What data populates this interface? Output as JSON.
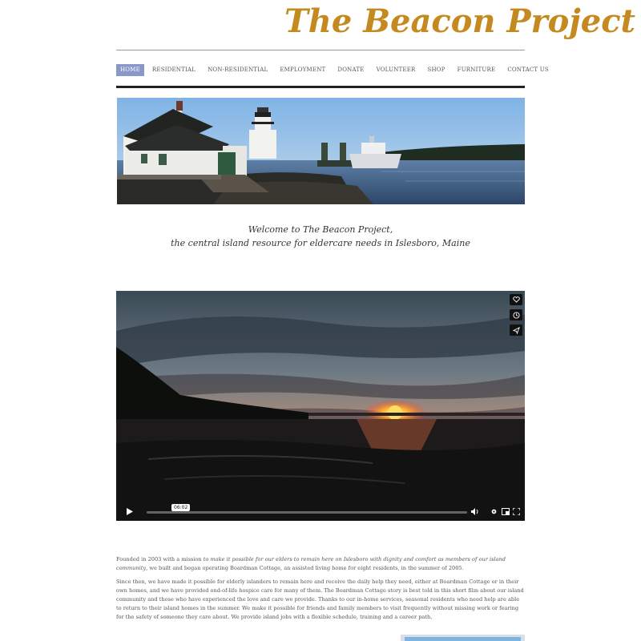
{
  "site": {
    "title": "The Beacon Project"
  },
  "nav": {
    "items": [
      {
        "label": "HOME",
        "active": true
      },
      {
        "label": "RESIDENTIAL"
      },
      {
        "label": "NON-RESIDENTIAL"
      },
      {
        "label": "EMPLOYMENT"
      },
      {
        "label": "DONATE"
      },
      {
        "label": "VOLUNTEER"
      },
      {
        "label": "SHOP"
      },
      {
        "label": "FURNITURE"
      },
      {
        "label": "CONTACT US"
      }
    ]
  },
  "hero": {
    "alt": "Lighthouse and cottage at dusk"
  },
  "welcome": {
    "line1": "Welcome to The Beacon Project,",
    "line2": "the central island resource for eldercare needs in Islesboro, Maine"
  },
  "video": {
    "timecode": "06:02",
    "side_buttons": [
      "heart-icon",
      "clock-icon",
      "send-icon"
    ],
    "controls": [
      "play-icon",
      "volume-icon",
      "settings-icon",
      "pip-icon",
      "fullscreen-icon"
    ]
  },
  "body": {
    "p1_a": "Founded in 2003 with a mission ",
    "p1_em": "to make it possible for our elders to remain here on Islesboro with dignity and comfort as members of our island community",
    "p1_b": ", we built and began operating Boardman Cottage, an assisted living home for eight residents, in the summer of 2005.",
    "p2": "Since then, we have made it possible for elderly islanders to remain here and receive the daily help they need, either at Boardman Cottage or in their own homes, and we have provided end-of-life hospice care for many of them. The Boardman Cottage story is best told in this short film about our island community and those who have experienced the love and care we provide. Thanks to our in-home services, seasonal residents who need help are able to return to their island homes in the summer.  We make it possible for friends and family members to visit frequently without missing work or fearing for the safety of someone they care about.  We provide island jobs with a flexible schedule, training and a career path."
  },
  "colors": {
    "title": "#c58a1f",
    "nav_active": "#8a98c8"
  }
}
